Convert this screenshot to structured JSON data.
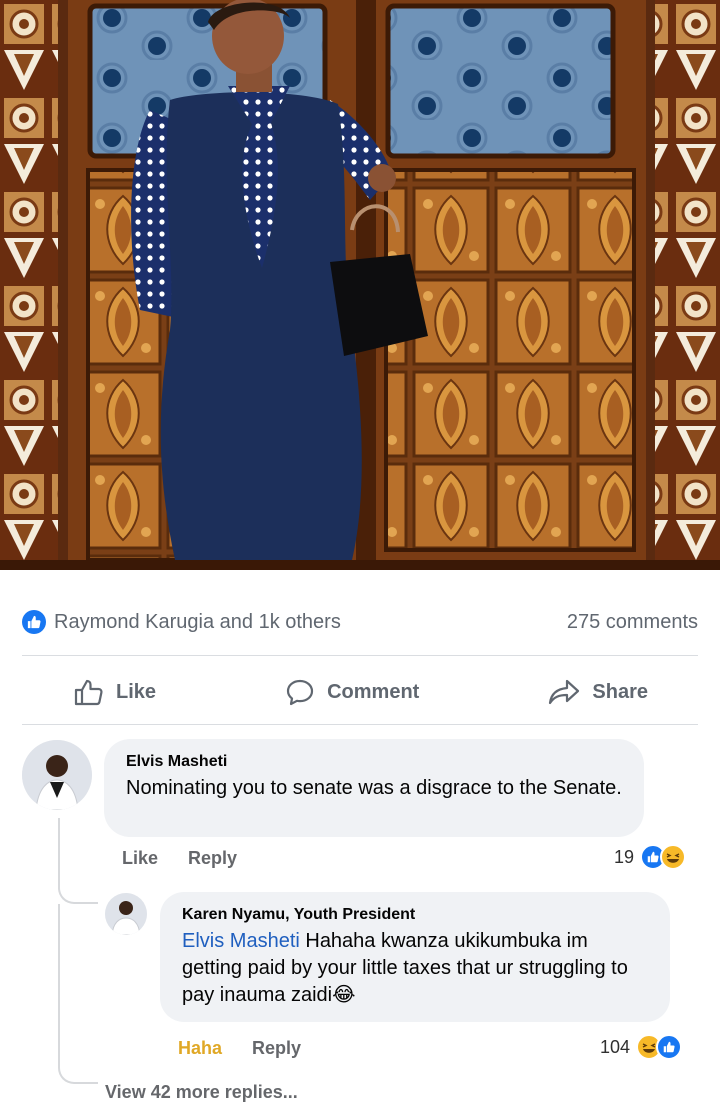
{
  "post": {
    "reactions_text": "Raymond Karugia and 1k others",
    "comments_count": "275 comments"
  },
  "actions": {
    "like": "Like",
    "comment": "Comment",
    "share": "Share"
  },
  "comments": [
    {
      "author": "Elvis Masheti",
      "text": "Nominating you to senate was a disgrace to the Senate.",
      "like_label": "Like",
      "reply_label": "Reply",
      "reaction_count": "19",
      "reactions": [
        "like",
        "haha"
      ]
    }
  ],
  "reply": {
    "author": "Karen Nyamu, Youth President",
    "mention": "Elvis Masheti",
    "text": " Hahaha kwanza ukikumbuka im getting paid by your little taxes that ur struggling to pay inauma zaidi",
    "emoji": "😂",
    "reaction_label": "Haha",
    "reply_label": "Reply",
    "reaction_count": "104",
    "reactions": [
      "haha",
      "like"
    ]
  },
  "more_replies": "View 42 more replies...",
  "colors": {
    "facebook_blue": "#1877f2",
    "haha_yellow": "#f7b928",
    "bubble_gray": "#f0f2f5",
    "meta_gray": "#65676b"
  }
}
